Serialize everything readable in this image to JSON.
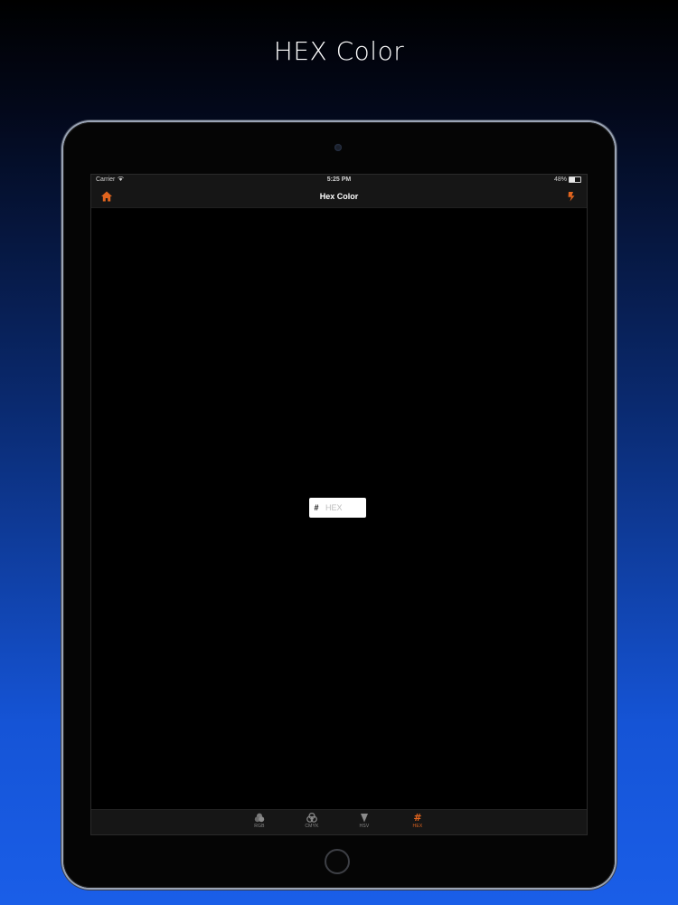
{
  "headline": "HEX Color",
  "status_bar": {
    "carrier": "Carrier",
    "time": "5:25 PM",
    "battery": "48%",
    "battery_level": 0.48
  },
  "nav": {
    "title": "Hex Color",
    "left_icon": "home-icon",
    "right_icon": "refresh-icon"
  },
  "hex_field": {
    "prefix": "#",
    "placeholder": "HEX",
    "value": ""
  },
  "tabs": [
    {
      "label": "RGB",
      "icon": "rgb-icon",
      "active": false
    },
    {
      "label": "CMYK",
      "icon": "cmyk-icon",
      "active": false
    },
    {
      "label": "HSV",
      "icon": "hsv-icon",
      "active": false
    },
    {
      "label": "HEX",
      "icon": "hex-icon",
      "active": true
    }
  ],
  "colors": {
    "accent": "#e0641e",
    "screen_bg": "#000000",
    "bar_bg": "#161616"
  }
}
